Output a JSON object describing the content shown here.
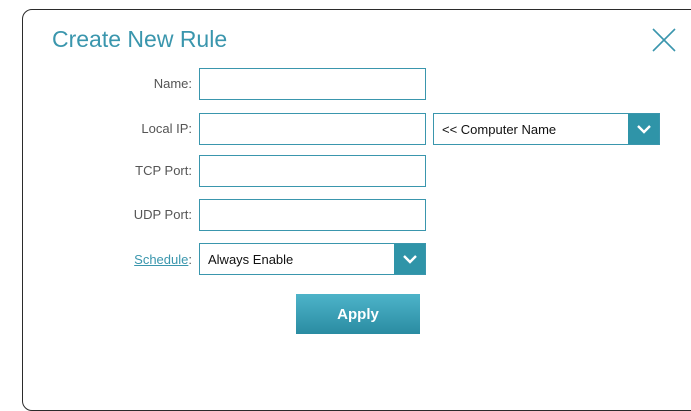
{
  "dialog": {
    "title": "Create New Rule",
    "close_icon": "close-icon"
  },
  "form": {
    "name": {
      "label": "Name:",
      "value": ""
    },
    "local_ip": {
      "label": "Local IP:",
      "value": "",
      "computer_select": {
        "value": "<< Computer Name",
        "icon": "chevron-down-icon"
      }
    },
    "tcp_port": {
      "label": "TCP Port:",
      "value": ""
    },
    "udp_port": {
      "label": "UDP Port:",
      "value": ""
    },
    "schedule": {
      "link_label": "Schedule",
      "suffix": ":",
      "select": {
        "value": "Always Enable",
        "icon": "chevron-down-icon"
      }
    },
    "apply_label": "Apply"
  },
  "colors": {
    "accent": "#3a96ad",
    "button": "#2f94a8",
    "label": "#555555"
  }
}
